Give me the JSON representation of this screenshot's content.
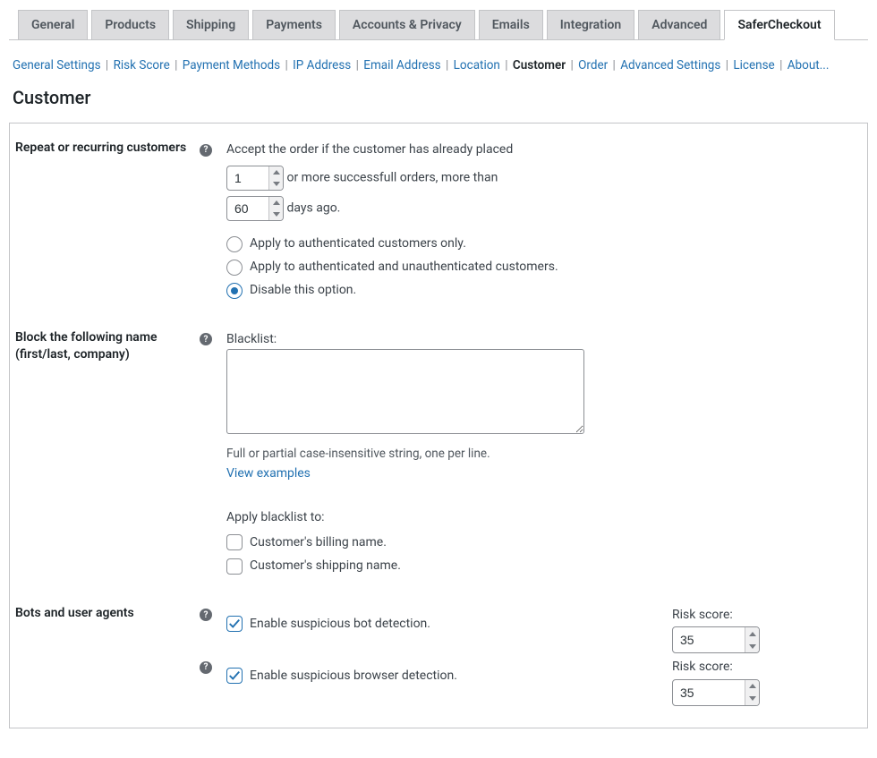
{
  "tabs": [
    {
      "label": "General"
    },
    {
      "label": "Products"
    },
    {
      "label": "Shipping"
    },
    {
      "label": "Payments"
    },
    {
      "label": "Accounts & Privacy"
    },
    {
      "label": "Emails"
    },
    {
      "label": "Integration"
    },
    {
      "label": "Advanced"
    },
    {
      "label": "SaferCheckout",
      "active": true
    }
  ],
  "subnav": {
    "items": [
      {
        "label": "General Settings"
      },
      {
        "label": "Risk Score"
      },
      {
        "label": "Payment Methods"
      },
      {
        "label": "IP Address"
      },
      {
        "label": "Email Address"
      },
      {
        "label": "Location"
      },
      {
        "label": "Customer",
        "current": true
      },
      {
        "label": "Order"
      },
      {
        "label": "Advanced Settings"
      },
      {
        "label": "License"
      },
      {
        "label": "About..."
      }
    ]
  },
  "section_title": "Customer",
  "repeat": {
    "label": "Repeat or recurring customers",
    "text1": "Accept the order if the customer has already placed",
    "orders_value": "1",
    "text2": "or more successfull orders, more than",
    "days_value": "60",
    "text3": "days ago.",
    "radio_auth": "Apply to authenticated customers only.",
    "radio_both": "Apply to authenticated and unauthenticated customers.",
    "radio_disable": "Disable this option.",
    "selected": "disable"
  },
  "blacklist": {
    "label": "Block the following name (first/last, company)",
    "heading": "Blacklist:",
    "value": "",
    "hint": "Full or partial case-insensitive string, one per line.",
    "link": "View examples",
    "apply_heading": "Apply blacklist to:",
    "billing": "Customer's billing name.",
    "shipping": "Customer's shipping name.",
    "billing_checked": false,
    "shipping_checked": false
  },
  "bots": {
    "label": "Bots and user agents",
    "bot_label": "Enable suspicious bot detection.",
    "bot_checked": true,
    "browser_label": "Enable suspicious browser detection.",
    "browser_checked": true,
    "risk_label": "Risk score:",
    "bot_risk": "35",
    "browser_risk": "35"
  }
}
